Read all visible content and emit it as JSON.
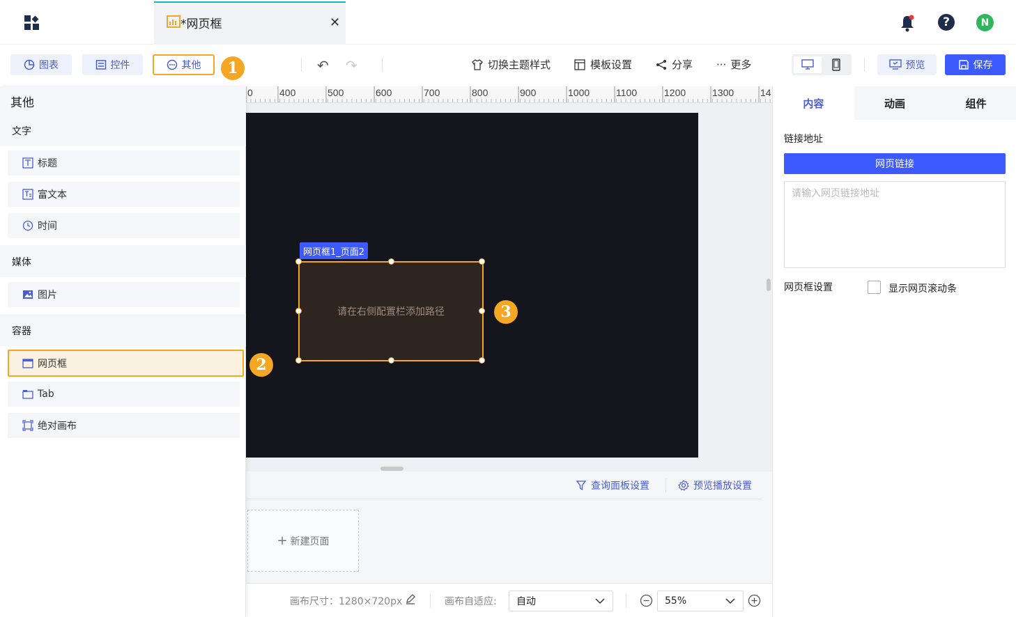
{
  "tab": {
    "title": "*网页框",
    "close": "✕"
  },
  "header": {
    "help": "?",
    "avatar": "N"
  },
  "toolbar": {
    "chart_label": "图表",
    "control_label": "控件",
    "other_label": "其他",
    "switch_theme": "切换主题样式",
    "template_settings": "模板设置",
    "share": "分享",
    "more": "更多",
    "preview": "预览",
    "save": "保存",
    "undo": "↶",
    "redo": "↷"
  },
  "badges": {
    "b1": "1",
    "b2": "2",
    "b3": "3"
  },
  "left_panel": {
    "title": "其他",
    "sections": {
      "text": "文字",
      "media": "媒体",
      "container": "容器"
    },
    "items": {
      "heading": "标题",
      "richtext": "富文本",
      "time": "时间",
      "image": "图片",
      "iframe": "网页框",
      "tab": "Tab",
      "absolute_canvas": "绝对画布"
    }
  },
  "ruler": {
    "ticks": [
      "0",
      "400",
      "500",
      "600",
      "700",
      "800",
      "900",
      "1000",
      "1100",
      "1200",
      "1300",
      "14"
    ]
  },
  "canvas": {
    "iframe_label": "网页框1_页面2",
    "iframe_placeholder": "请在右侧配置栏添加路径"
  },
  "pages": {
    "query_panel": "查询面板设置",
    "preview_play": "预览播放设置",
    "new_page": "新建页面",
    "plus": "+"
  },
  "bottom": {
    "canvas_size": "画布尺寸：1280×720px",
    "fit_label": "画布自适应:",
    "fit_value": "自动",
    "zoom_value": "55%"
  },
  "right_panel": {
    "tabs": [
      "内容",
      "动画",
      "组件"
    ],
    "link_label": "链接地址",
    "link_button": "网页链接",
    "link_placeholder": "请输入网页链接地址",
    "link_value": "",
    "iframe_settings": "网页框设置",
    "show_scrollbar": "显示网页滚动条"
  },
  "colors": {
    "accent": "#3d5afe",
    "highlight": "#f5a623",
    "canvas_bg": "#14151d"
  }
}
